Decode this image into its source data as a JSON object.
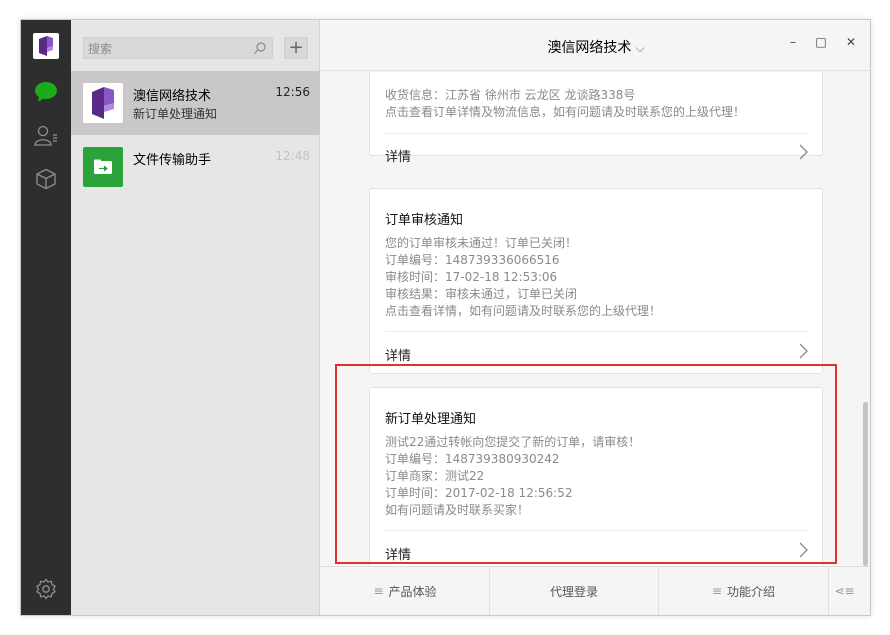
{
  "rail": {
    "icons": [
      "app-logo-icon",
      "chat-bubble-icon",
      "contacts-icon",
      "box-icon",
      "gear-icon"
    ],
    "active_color": "#1aad19"
  },
  "list": {
    "search_placeholder": "搜索",
    "add_label": "+",
    "conversations": [
      {
        "name": "澳信网络技术",
        "preview": "新订单处理通知",
        "time": "12:56",
        "active": true
      },
      {
        "name": "文件传输助手",
        "preview": "",
        "time": "12:48",
        "active": false
      }
    ]
  },
  "chat": {
    "title": "澳信网络技术",
    "title_chevron": "⌵",
    "window_controls": {
      "minimize": "–",
      "maximize": "□",
      "close": "✕"
    },
    "cards": [
      {
        "title": "",
        "lines": [
          "收货信息：江苏省 徐州市 云龙区 龙谈路338号",
          "点击查看订单详情及物流信息，如有问题请及时联系您的上级代理！"
        ],
        "detail": "详情"
      },
      {
        "title": "订单审核通知",
        "lines": [
          "您的订单审核未通过！订单已关闭！",
          "订单编号：148739336066516",
          "审核时间：17-02-18 12:53:06",
          "审核结果：审核未通过，订单已关闭",
          "点击查看详情，如有问题请及时联系您的上级代理！"
        ],
        "detail": "详情"
      },
      {
        "title": "新订单处理通知",
        "lines": [
          "测试22通过转帐向您提交了新的订单，请审核！",
          "订单编号：148739380930242",
          "订单商家：测试22",
          "订单时间：2017-02-18 12:56:52",
          "如有问题请及时联系买家！"
        ],
        "detail": "详情"
      }
    ],
    "highlight_color": "#e0312e"
  },
  "footer": {
    "menus": [
      "产品体验",
      "代理登录",
      "功能介绍"
    ],
    "menu_icon": "≡",
    "keyboard_toggle": "⋖≡"
  }
}
